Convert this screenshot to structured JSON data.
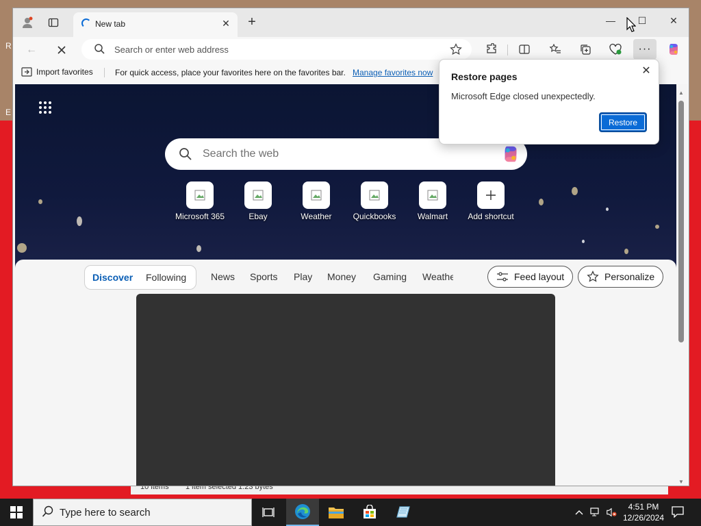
{
  "desktop": {
    "edge_letter_1": "R",
    "edge_letter_2": "E"
  },
  "background_explorer": {
    "items": "10 items",
    "selected": "1 item selected  1.23 bytes"
  },
  "browser": {
    "tab": {
      "title": "New tab"
    },
    "address_bar": {
      "placeholder": "Search or enter web address"
    },
    "favorites_bar": {
      "import_label": "Import favorites",
      "hint": "For quick access, place your favorites here on the favorites bar.",
      "manage_link": "Manage favorites now"
    },
    "new_tab_page": {
      "search_placeholder": "Search the web",
      "shortcuts": [
        {
          "label": "Microsoft 365"
        },
        {
          "label": "Ebay"
        },
        {
          "label": "Weather"
        },
        {
          "label": "Quickbooks"
        },
        {
          "label": "Walmart"
        },
        {
          "label": "Add shortcut"
        }
      ],
      "feed_tabs": {
        "discover": "Discover",
        "following": "Following",
        "others": [
          "News",
          "Sports",
          "Play",
          "Money",
          "Gaming",
          "Weathe"
        ]
      },
      "feed_layout_label": "Feed layout",
      "personalize_label": "Personalize"
    },
    "restore_popup": {
      "title": "Restore pages",
      "message": "Microsoft Edge closed unexpectedly.",
      "button": "Restore"
    }
  },
  "taskbar": {
    "search_placeholder": "Type here to search",
    "time": "4:51 PM",
    "date": "12/26/2024"
  },
  "colors": {
    "accent": "#0a6bd6",
    "link": "#0a5eb5",
    "desktop_red": "#e31b23",
    "hero_bg": "#0b1533",
    "feed_card": "#323232"
  }
}
